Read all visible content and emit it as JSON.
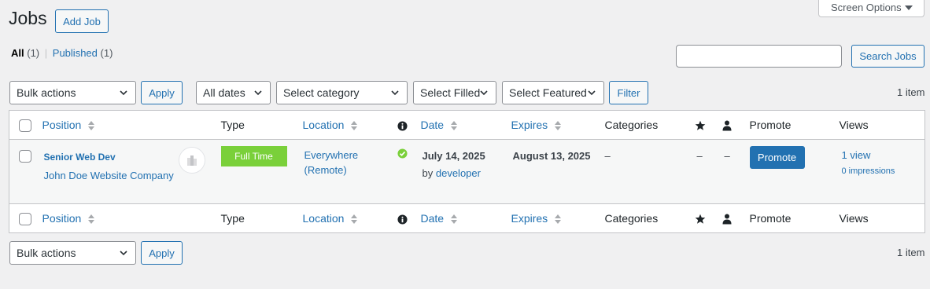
{
  "header": {
    "title": "Jobs",
    "add_job_label": "Add Job",
    "screen_options_label": "Screen Options"
  },
  "filters_status": {
    "all_label": "All",
    "all_count": "(1)",
    "separator": "|",
    "published_label": "Published",
    "published_count": "(1)"
  },
  "search": {
    "value": "",
    "button_label": "Search Jobs"
  },
  "top_nav": {
    "bulk_actions": "Bulk actions",
    "apply_label": "Apply",
    "dates": "All dates",
    "category": "Select category",
    "filled": "Select Filled",
    "featured": "Select Featured",
    "filter_label": "Filter",
    "item_count": "1 item"
  },
  "columns": {
    "position": "Position",
    "type": "Type",
    "location": "Location",
    "date": "Date",
    "expires": "Expires",
    "categories": "Categories",
    "promote": "Promote",
    "views": "Views"
  },
  "rows": [
    {
      "title": "Senior Web Dev",
      "company": "John Doe Website Company",
      "type": "Full Time",
      "location_line1": "Everywhere",
      "location_line2": "(Remote)",
      "date": "July 14, 2025",
      "by_label": "by",
      "author": "developer",
      "expires": "August 13, 2025",
      "categories": "–",
      "featured": "–",
      "filled": "–",
      "promote_label": "Promote",
      "views": "1 view",
      "impressions": "0 impressions"
    }
  ],
  "bottom_nav": {
    "bulk_actions": "Bulk actions",
    "apply_label": "Apply",
    "item_count": "1 item"
  },
  "colors": {
    "accent": "#2271b1",
    "fulltime_badge": "#7ad03a",
    "status_published": "#68de7c",
    "background": "#f0f0f1"
  }
}
